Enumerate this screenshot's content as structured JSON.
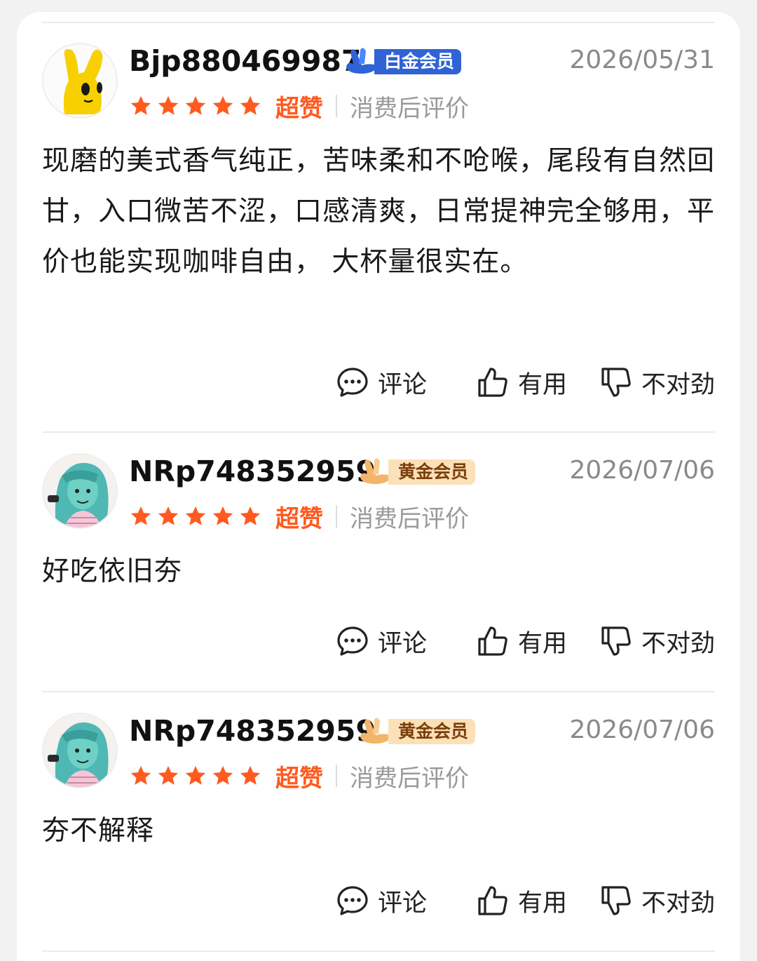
{
  "reviews": [
    {
      "username": "Bjp880469987",
      "badge": {
        "type": "platinum",
        "label": "白金会员"
      },
      "date": "2026/05/31",
      "stars": 5,
      "rating_label": "超赞",
      "tag": "消费后评价",
      "content": "现磨的美式香气纯正，苦味柔和不呛喉，尾段有自然回甘，入口微苦不涩，口感清爽，日常提神完全够用，平价也能实现咖啡自由， 大杯量很实在。",
      "avatar": "yellow-bunny",
      "actions": {
        "comment": "评论",
        "useful": "有用",
        "wrong": "不对劲"
      }
    },
    {
      "username": "NRp748352959",
      "badge": {
        "type": "gold",
        "label": "黄金会员"
      },
      "date": "2026/07/06",
      "stars": 5,
      "rating_label": "超赞",
      "tag": "消费后评价",
      "content": "好吃依旧夯",
      "avatar": "teal-hair-girl",
      "actions": {
        "comment": "评论",
        "useful": "有用",
        "wrong": "不对劲"
      }
    },
    {
      "username": "NRp748352959",
      "badge": {
        "type": "gold",
        "label": "黄金会员"
      },
      "date": "2026/07/06",
      "stars": 5,
      "rating_label": "超赞",
      "tag": "消费后评价",
      "content": "夯不解释",
      "avatar": "teal-hair-girl",
      "actions": {
        "comment": "评论",
        "useful": "有用",
        "wrong": "不对劲"
      }
    }
  ],
  "colors": {
    "star": "#ff5a1f",
    "platinum_badge": "#2f63d6",
    "gold_badge": "#fbe0b8"
  },
  "icons": [
    "comment-icon",
    "thumb-up-icon",
    "thumb-down-icon",
    "star-icon"
  ]
}
